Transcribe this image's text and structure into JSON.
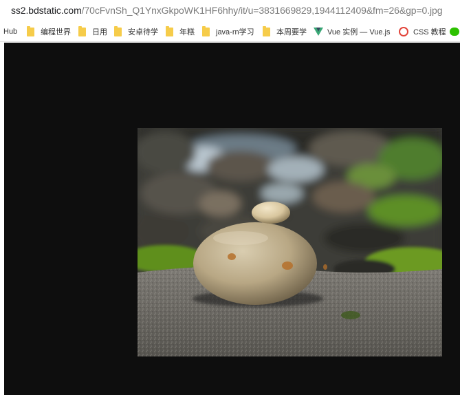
{
  "browser": {
    "url_host": "ss2.bdstatic.com",
    "url_path": "/70cFvnSh_Q1YnxGkpoWK1HF6hhy/it/u=3831669829,1944112409&fm=26&gp=0.jpg"
  },
  "bookmarks": [
    {
      "label": "Hub",
      "icon": "none"
    },
    {
      "label": "编程世界",
      "icon": "folder-icon"
    },
    {
      "label": "日用",
      "icon": "folder-icon"
    },
    {
      "label": "安卓待学",
      "icon": "folder-icon"
    },
    {
      "label": "年糕",
      "icon": "folder-icon"
    },
    {
      "label": "java-rn学习",
      "icon": "folder-icon"
    },
    {
      "label": "本周要学",
      "icon": "folder-icon"
    },
    {
      "label": "Vue 实例 — Vue.js",
      "icon": "vue-icon"
    },
    {
      "label": "CSS 教程",
      "icon": "css-icon"
    },
    {
      "label": "",
      "icon": "wechat-icon"
    }
  ],
  "image": {
    "subject": "stacked-stones-photo"
  }
}
